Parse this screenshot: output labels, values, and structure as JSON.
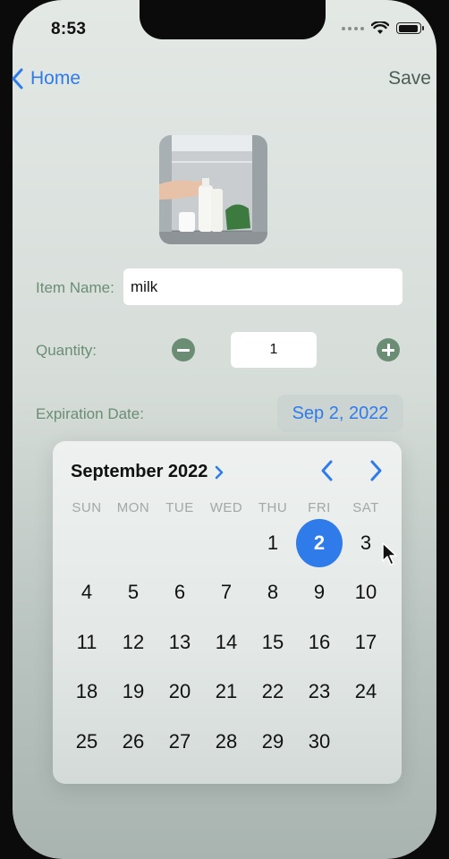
{
  "status_bar": {
    "time": "8:53",
    "icons": [
      "signal-dots-icon",
      "wifi-icon",
      "battery-icon"
    ]
  },
  "nav": {
    "back_label": "Home",
    "save_label": "Save"
  },
  "form": {
    "photo_icon": "milk-in-fridge-photo",
    "item_name_label": "Item Name:",
    "item_name_value": "milk",
    "quantity_label": "Quantity:",
    "quantity_value": "1",
    "expiration_label": "Expiration Date:",
    "expiration_value": "Sep 2, 2022"
  },
  "calendar": {
    "month_title": "September 2022",
    "weekdays": [
      "SUN",
      "MON",
      "TUE",
      "WED",
      "THU",
      "FRI",
      "SAT"
    ],
    "leading_blanks": 4,
    "days": [
      "1",
      "2",
      "3",
      "4",
      "5",
      "6",
      "7",
      "8",
      "9",
      "10",
      "11",
      "12",
      "13",
      "14",
      "15",
      "16",
      "17",
      "18",
      "19",
      "20",
      "21",
      "22",
      "23",
      "24",
      "25",
      "26",
      "27",
      "28",
      "29",
      "30"
    ],
    "selected_day": "2"
  },
  "colors": {
    "accent": "#2f7bea",
    "label_green": "#6b8d74",
    "save_gray": "#4d5c55"
  }
}
